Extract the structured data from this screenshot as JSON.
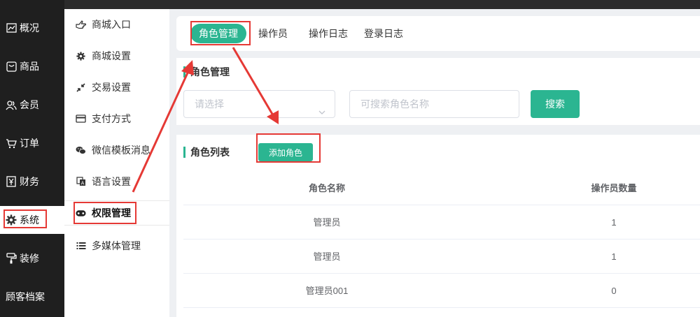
{
  "sidebar1": {
    "items": [
      {
        "label": "概况",
        "icon": "chart-icon"
      },
      {
        "label": "商品",
        "icon": "box-icon"
      },
      {
        "label": "会员",
        "icon": "users-icon"
      },
      {
        "label": "订单",
        "icon": "cart-icon"
      },
      {
        "label": "财务",
        "icon": "yen-icon"
      },
      {
        "label": "系统",
        "icon": "gear-icon"
      },
      {
        "label": "装修",
        "icon": "paint-roller-icon"
      },
      {
        "label": "顾客档案",
        "icon": ""
      }
    ],
    "active": "系统"
  },
  "sidebar2": {
    "items": [
      {
        "label": "商城入口",
        "icon": "pointer-hand-icon"
      },
      {
        "label": "商城设置",
        "icon": "cog-icon"
      },
      {
        "label": "交易设置",
        "icon": "compress-arrows-icon"
      },
      {
        "label": "支付方式",
        "icon": "credit-card-icon"
      },
      {
        "label": "微信模板消息",
        "icon": "wechat-icon"
      },
      {
        "label": "语言设置",
        "icon": "translate-icon"
      },
      {
        "label": "权限管理",
        "icon": "gamepad-icon"
      },
      {
        "label": "多媒体管理",
        "icon": "list-icon"
      }
    ],
    "active": "权限管理"
  },
  "tabs": [
    {
      "label": "角色管理"
    },
    {
      "label": "操作员"
    },
    {
      "label": "操作日志"
    },
    {
      "label": "登录日志"
    }
  ],
  "filter": {
    "title": "角色管理",
    "select_placeholder": "请选择",
    "search_placeholder": "可搜索角色名称",
    "search_button": "搜索"
  },
  "list": {
    "title": "角色列表",
    "add_button": "添加角色",
    "columns": [
      "角色名称",
      "操作员数量"
    ],
    "rows": [
      [
        "管理员",
        "1"
      ],
      [
        "管理员",
        "1"
      ],
      [
        "管理员001",
        "0"
      ]
    ]
  },
  "colors": {
    "accent": "#2bb591",
    "annotation": "#e53935",
    "sidebar_bg": "#1f1f1f"
  }
}
